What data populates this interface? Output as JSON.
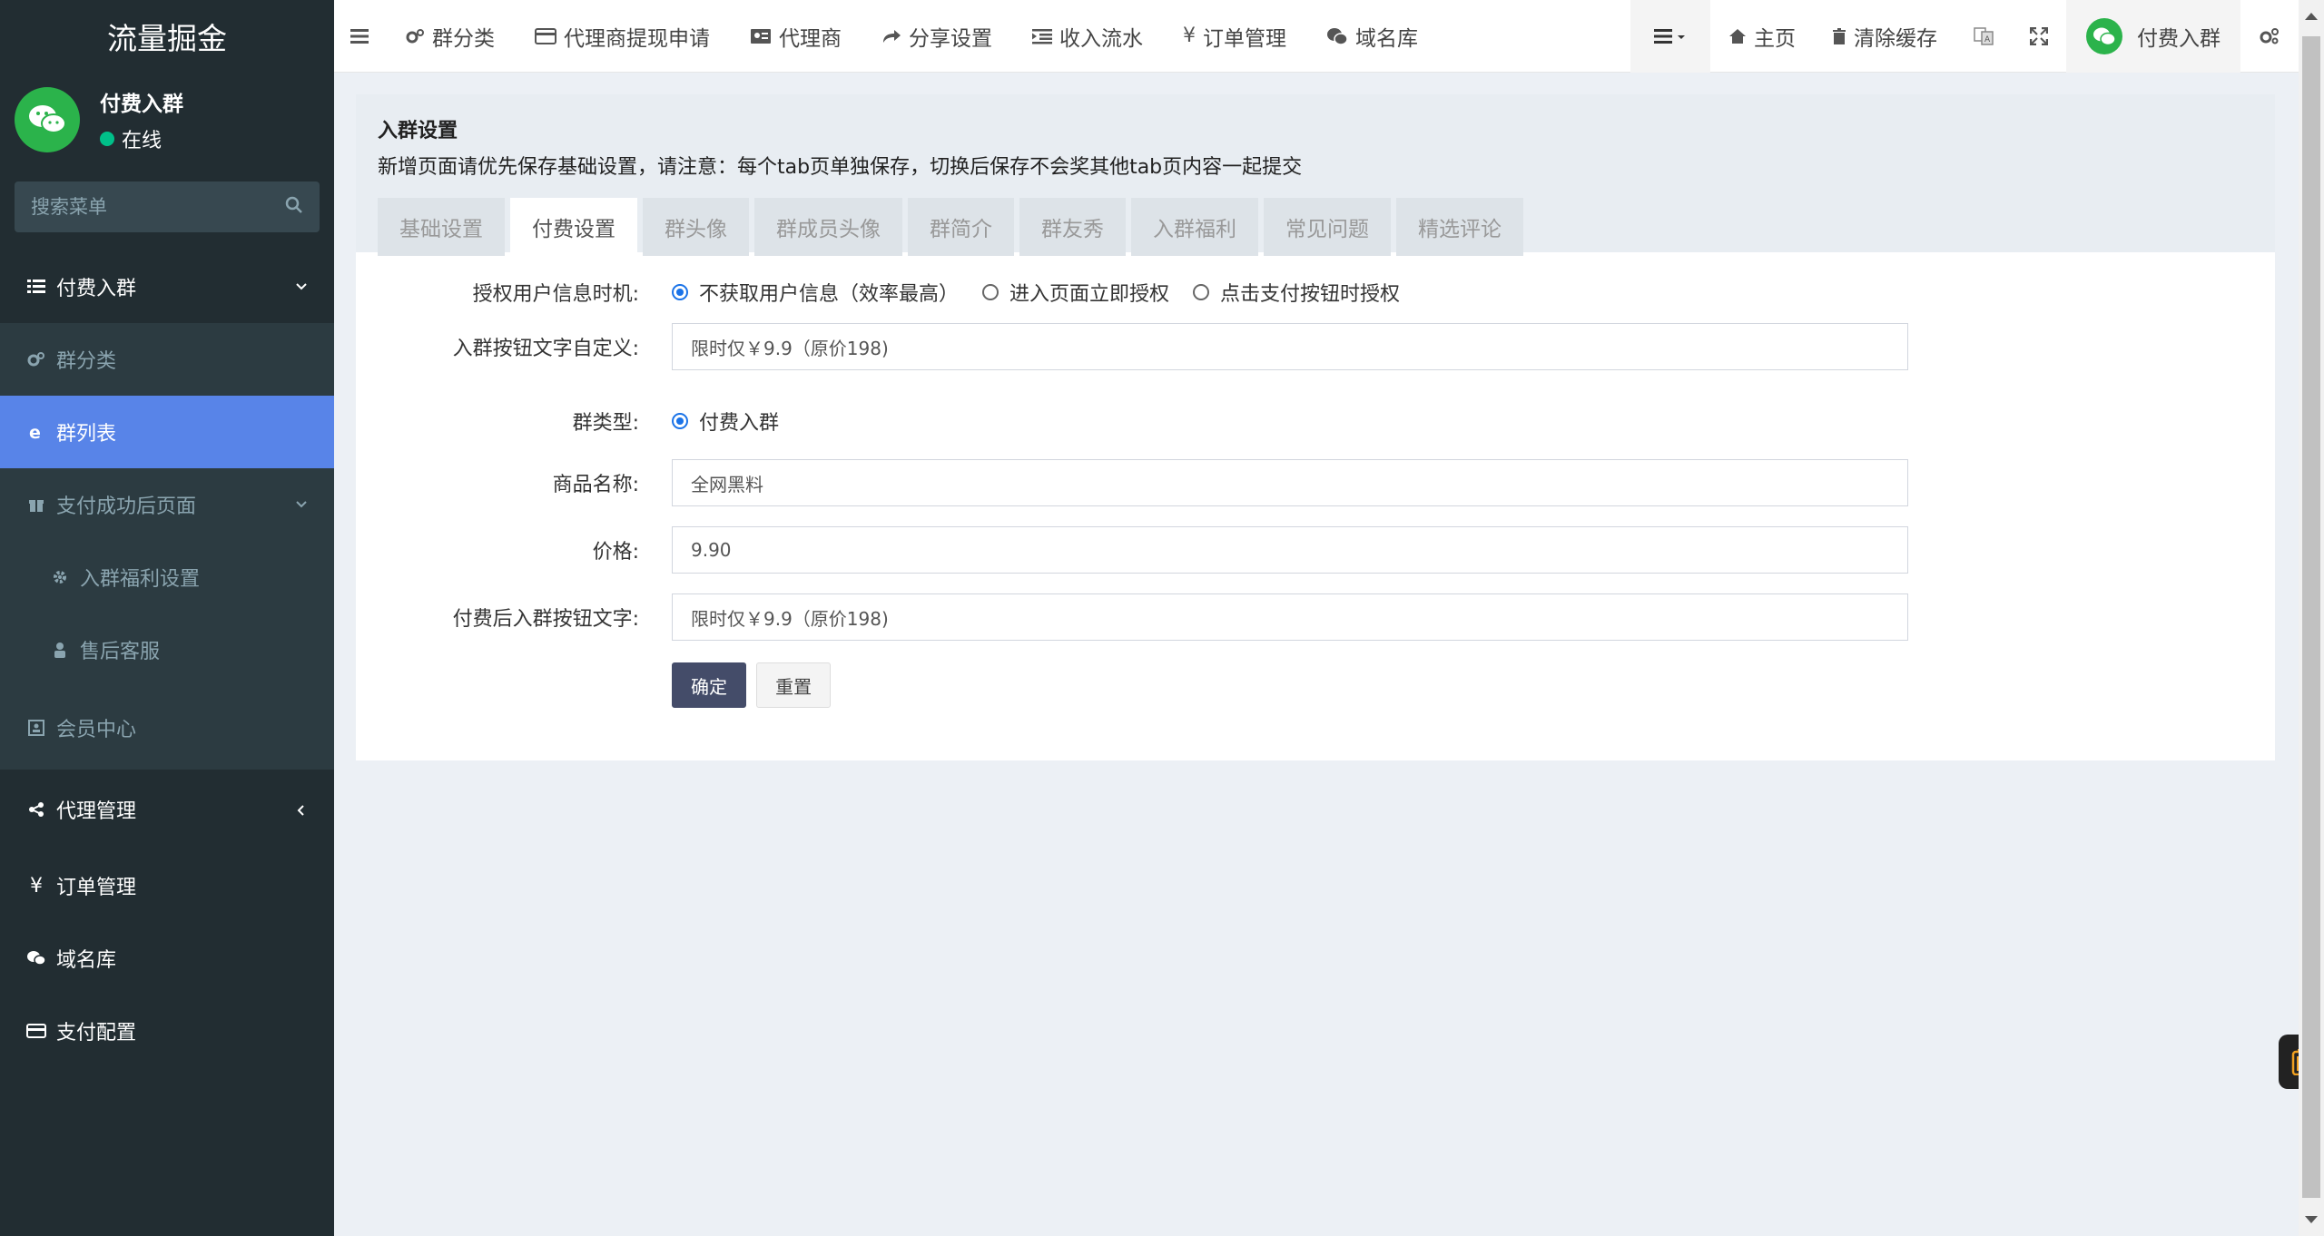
{
  "sidebar": {
    "logo": "流量掘金",
    "user": {
      "name": "付费入群",
      "status": "在线"
    },
    "search_placeholder": "搜索菜单",
    "menu": {
      "group_main": "付费入群",
      "group_category": "群分类",
      "group_list": "群列表",
      "after_pay": "支付成功后页面",
      "welfare": "入群福利设置",
      "service": "售后客服",
      "member": "会员中心",
      "agent": "代理管理",
      "orders": "订单管理",
      "domains": "域名库",
      "pay": "支付配置"
    }
  },
  "navbar": {
    "items": [
      "群分类",
      "代理商提现申请",
      "代理商",
      "分享设置",
      "收入流水",
      "订单管理",
      "域名库"
    ],
    "home": "主页",
    "clear_cache": "清除缓存",
    "user": "付费入群"
  },
  "panel": {
    "title": "入群设置",
    "note": "新增页面请优先保存基础设置，请注意：每个tab页单独保存，切换后保存不会奖其他tab页内容一起提交",
    "tabs": [
      "基础设置",
      "付费设置",
      "群头像",
      "群成员头像",
      "群简介",
      "群友秀",
      "入群福利",
      "常见问题",
      "精选评论"
    ],
    "active_tab": "付费设置"
  },
  "form": {
    "auth_label": "授权用户信息时机:",
    "auth_options": [
      "不获取用户信息（效率最高）",
      "进入页面立即授权",
      "点击支付按钮时授权"
    ],
    "auth_selected": "不获取用户信息（效率最高）",
    "btn_text_label": "入群按钮文字自定义:",
    "btn_text_value": "限时仅￥9.9（原价198)",
    "group_type_label": "群类型:",
    "group_type_option": "付费入群",
    "product_label": "商品名称:",
    "product_value": "全网黑料",
    "price_label": "价格:",
    "price_value": "9.90",
    "after_pay_label": "付费后入群按钮文字:",
    "after_pay_value": "限时仅￥9.9（原价198)",
    "submit": "确定",
    "reset": "重置"
  },
  "colors": {
    "sidebar_bg": "#222d32",
    "active_menu": "#5884e8",
    "primary_btn": "#444c69",
    "wechat_green": "#2bb34b"
  }
}
